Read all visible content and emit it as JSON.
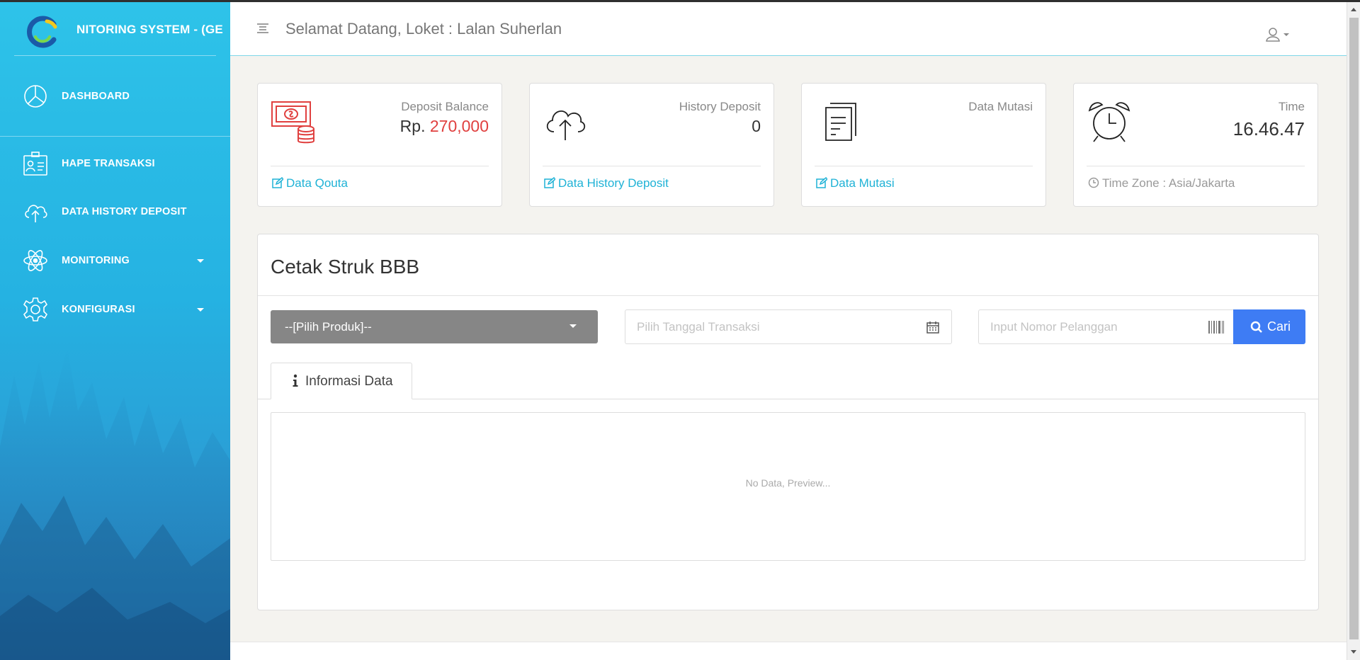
{
  "app": {
    "title": "NITORING SYSTEM - (GE"
  },
  "sidebar": {
    "items": [
      {
        "label": "DASHBOARD",
        "icon": "pie-chart-icon"
      },
      {
        "label": "HAPE TRANSAKSI",
        "icon": "id-card-icon"
      },
      {
        "label": "DATA HISTORY DEPOSIT",
        "icon": "cloud-upload-icon"
      },
      {
        "label": "MONITORING",
        "icon": "atom-icon",
        "has_submenu": true
      },
      {
        "label": "KONFIGURASI",
        "icon": "gear-icon",
        "has_submenu": true
      }
    ]
  },
  "header": {
    "welcome": "Selamat Datang, Loket : Lalan Suherlan"
  },
  "cards": [
    {
      "label": "Deposit Balance",
      "value_prefix": "Rp.",
      "value": "270,000",
      "link": "Data Qouta",
      "icon": "money-coins-icon"
    },
    {
      "label": "History Deposit",
      "value": "0",
      "link": "Data History Deposit",
      "icon": "cloud-upload-icon"
    },
    {
      "label": "Data Mutasi",
      "value": "",
      "link": "Data Mutasi",
      "icon": "documents-icon"
    },
    {
      "label": "Time",
      "value": "16.46.47",
      "link": "Time Zone : Asia/Jakarta",
      "icon": "alarm-clock-icon"
    }
  ],
  "panel": {
    "title": "Cetak Struk BBB",
    "product_select": "--[Pilih Produk]--",
    "date_placeholder": "Pilih Tanggal Transaksi",
    "customer_placeholder": "Input Nomor Pelanggan",
    "search_button": "Cari",
    "tab_label": "Informasi Data",
    "empty_text": "No Data, Preview..."
  },
  "colors": {
    "sidebar_top": "#2ec3e9",
    "sidebar_bottom": "#2a8fce",
    "accent": "#1fb2d6",
    "balance_red": "#e0403f",
    "button_blue": "#3e7cf4",
    "select_gray": "#868686"
  }
}
